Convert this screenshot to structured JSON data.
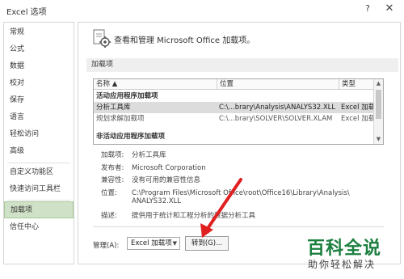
{
  "window": {
    "title": "Excel 选项",
    "help_glyph": "?",
    "close_glyph": "✕"
  },
  "sidebar": {
    "items": [
      {
        "label": "常规"
      },
      {
        "label": "公式"
      },
      {
        "label": "数据"
      },
      {
        "label": "校对"
      },
      {
        "label": "保存"
      },
      {
        "label": "语言"
      },
      {
        "label": "轻松访问"
      },
      {
        "label": "高级"
      },
      {
        "label": "自定义功能区"
      },
      {
        "label": "快速访问工具栏"
      },
      {
        "label": "加载项",
        "active": true
      },
      {
        "label": "信任中心"
      }
    ]
  },
  "header": {
    "icon": "addin-gear-icon",
    "text": "查看和管理 Microsoft Office 加载项。"
  },
  "section_title": "加载项",
  "table": {
    "columns": [
      "名称 ▲",
      "位置",
      "类型"
    ],
    "groups": [
      {
        "label": "活动应用程序加载项",
        "rows": [
          {
            "name": "分析工具库",
            "location": "C:\\...brary\\Analysis\\ANALYS32.XLL",
            "type": "Excel 加载项",
            "selected": true
          }
        ]
      },
      {
        "label": "非活动应用程序加载项",
        "rows": []
      }
    ],
    "prefill_rows": [
      {
        "name": "规划求解加载项",
        "location": "C:\\...brary\\SOLVER\\SOLVER.XLAM",
        "type": "Excel 加载项"
      }
    ]
  },
  "details": {
    "addin": {
      "label": "加载项:",
      "value": "分析工具库"
    },
    "publisher": {
      "label": "发布者:",
      "value": "Microsoft Corporation"
    },
    "compat": {
      "label": "兼容性:",
      "value": "没有可用的兼容性信息"
    },
    "location": {
      "label": "位置:",
      "value_line1": "C:\\Program Files\\Microsoft Office\\root\\Office16\\Library\\Analysis\\",
      "value_line2": "ANALYS32.XLL"
    },
    "description": {
      "label": "描述:",
      "value": "提供用于统计和工程分析的数据分析工具"
    }
  },
  "manage": {
    "label": "管理(A):",
    "selected": "Excel 加载项",
    "goto_label": "转到(G)..."
  },
  "annotation_color": "#e02020",
  "watermark": {
    "main": "百科全说",
    "sub": "助你轻松解决"
  }
}
